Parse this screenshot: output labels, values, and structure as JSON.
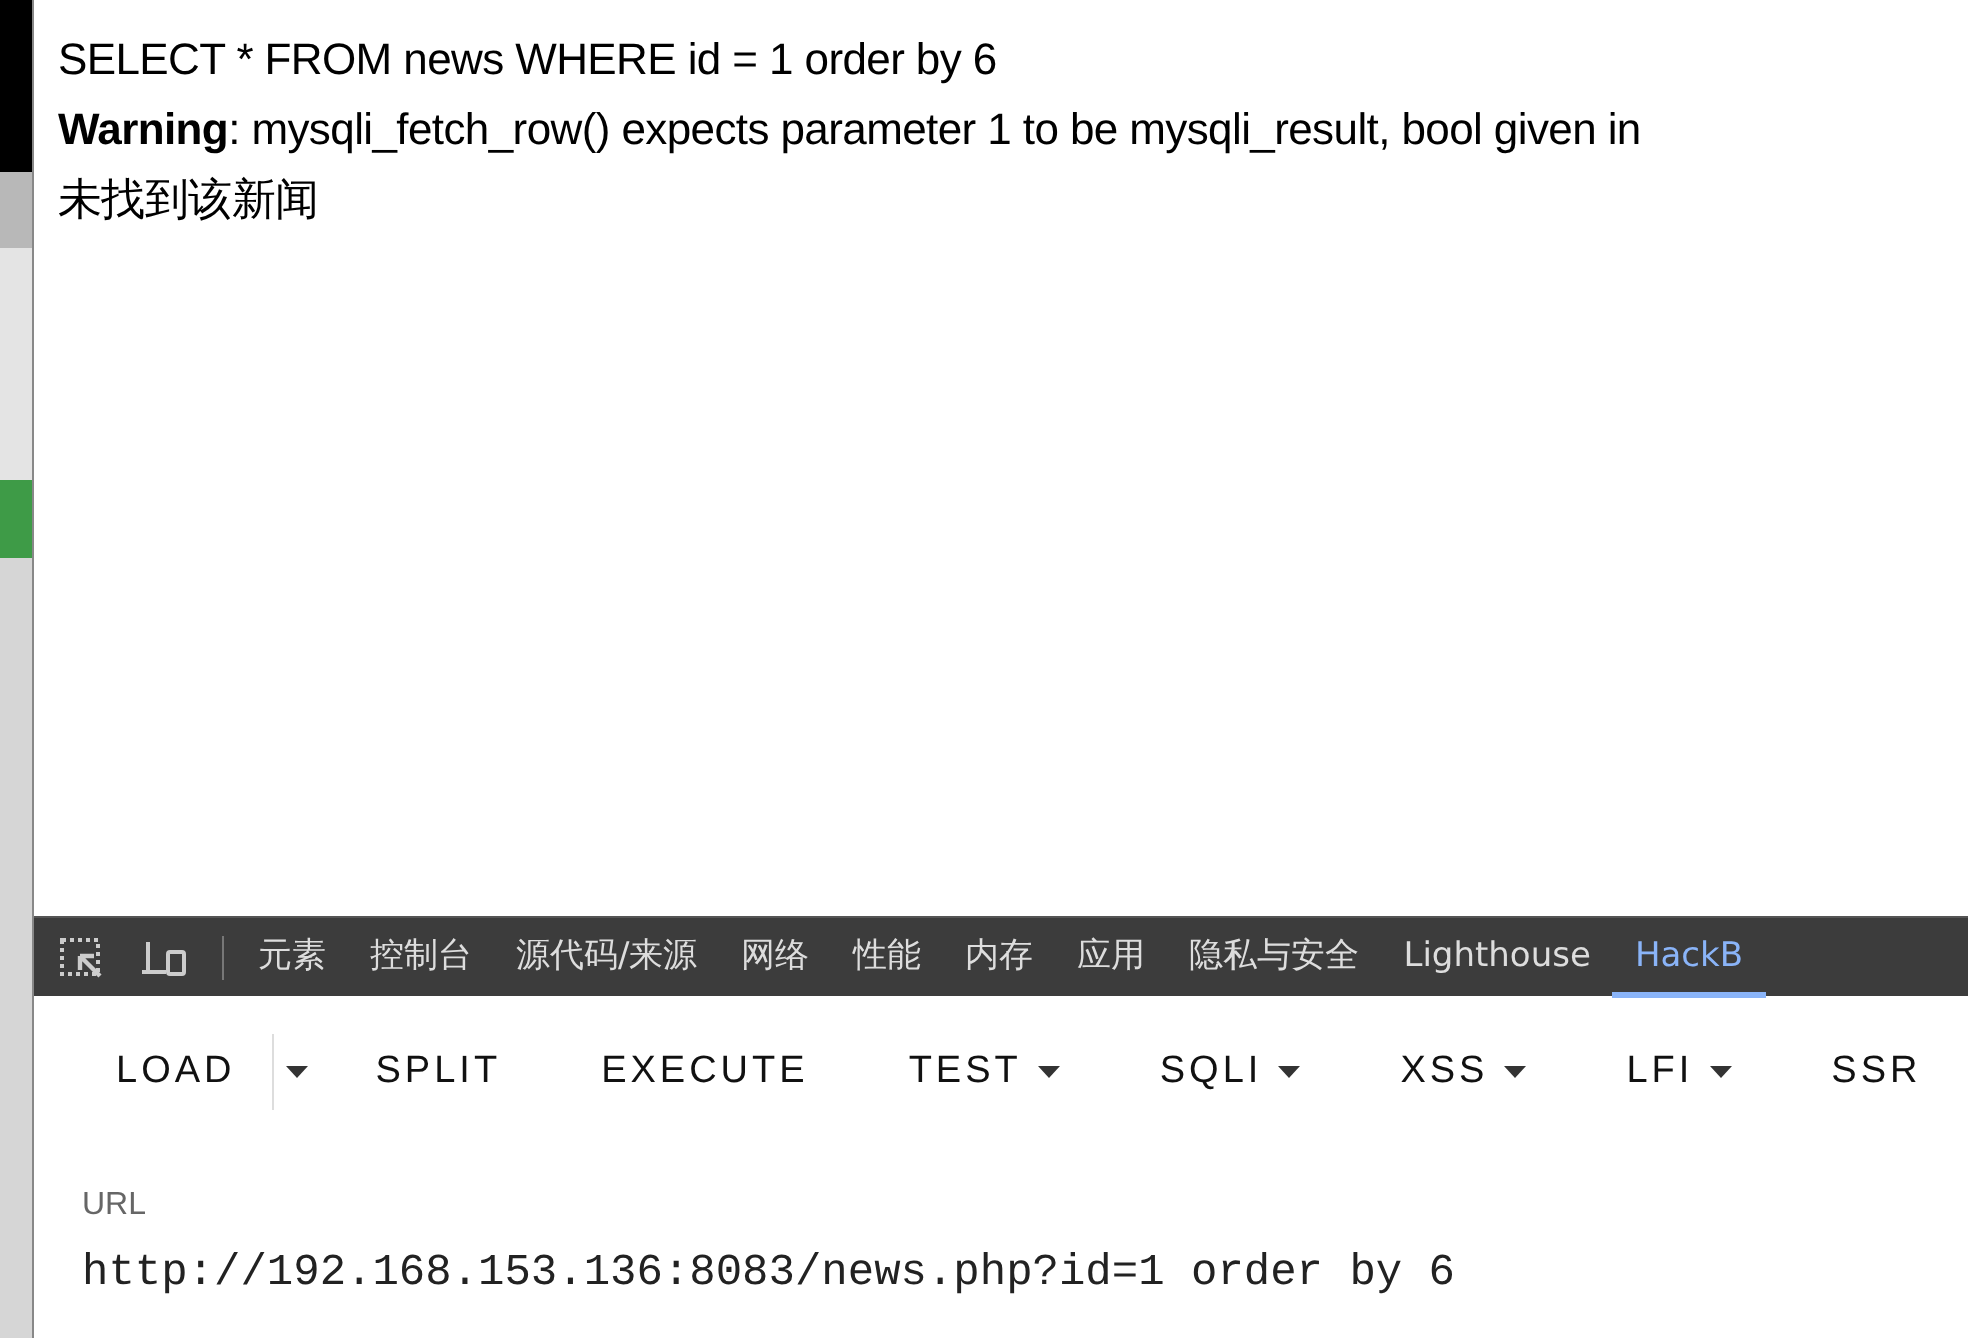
{
  "page": {
    "lines": [
      {
        "kind": "plain",
        "text": "SELECT * FROM news WHERE id = 1 order by 6"
      },
      {
        "kind": "rich",
        "text": "**Warning**: mysqli_fetch_row() expects parameter 1 to be mysqli_result, bool given in"
      },
      {
        "kind": "plain",
        "text": "未找到该新闻"
      }
    ]
  },
  "devtools": {
    "tabs": [
      {
        "label": "元素",
        "selected": false
      },
      {
        "label": "控制台",
        "selected": false
      },
      {
        "label": "源代码/来源",
        "selected": false
      },
      {
        "label": "网络",
        "selected": false
      },
      {
        "label": "性能",
        "selected": false
      },
      {
        "label": "内存",
        "selected": false
      },
      {
        "label": "应用",
        "selected": false
      },
      {
        "label": "隐私与安全",
        "selected": false
      },
      {
        "label": "Lighthouse",
        "selected": false
      },
      {
        "label": "HackB",
        "selected": true
      }
    ]
  },
  "hackbar": {
    "toolbar": [
      {
        "kind": "button",
        "label": "LOAD"
      },
      {
        "kind": "split-caret"
      },
      {
        "kind": "button",
        "label": "SPLIT"
      },
      {
        "kind": "button",
        "label": "EXECUTE"
      },
      {
        "kind": "menu",
        "label": "TEST"
      },
      {
        "kind": "menu",
        "label": "SQLI"
      },
      {
        "kind": "menu",
        "label": "XSS"
      },
      {
        "kind": "menu",
        "label": "LFI"
      },
      {
        "kind": "button",
        "label": "SSR"
      }
    ],
    "url_label": "URL",
    "url_value": "http://192.168.153.136:8083/news.php?id=1 order by 6"
  }
}
